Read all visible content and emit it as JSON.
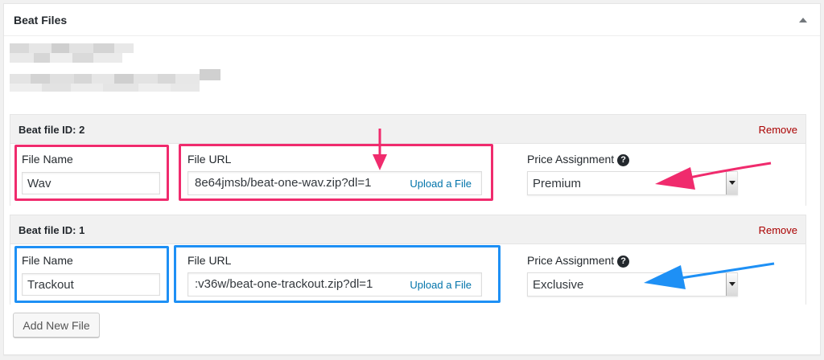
{
  "metabox": {
    "title": "Beat Files",
    "collapse_icon": "triangle-up-icon"
  },
  "beat_files": [
    {
      "title": "Beat file ID: 2",
      "remove_label": "Remove",
      "file_name_label": "File Name",
      "file_name_value": "Wav",
      "file_url_label": "File URL",
      "file_url_value": "8e64jmsb/beat-one-wav.zip?dl=1",
      "upload_label": "Upload a File",
      "price_label": "Price Assignment",
      "help_icon": "?",
      "price_value": "Premium",
      "highlight_color": "#f02b6d"
    },
    {
      "title": "Beat file ID: 1",
      "remove_label": "Remove",
      "file_name_label": "File Name",
      "file_name_value": "Trackout",
      "file_url_label": "File URL",
      "file_url_value": ":v36w/beat-one-trackout.zip?dl=1",
      "upload_label": "Upload a File",
      "price_label": "Price Assignment",
      "help_icon": "?",
      "price_value": "Exclusive",
      "highlight_color": "#1e90f5"
    }
  ],
  "add_button_label": "Add New File",
  "colors": {
    "remove": "#aa0000",
    "link": "#0073aa",
    "pink_annotation": "#f02b6d",
    "blue_annotation": "#1e90f5"
  }
}
